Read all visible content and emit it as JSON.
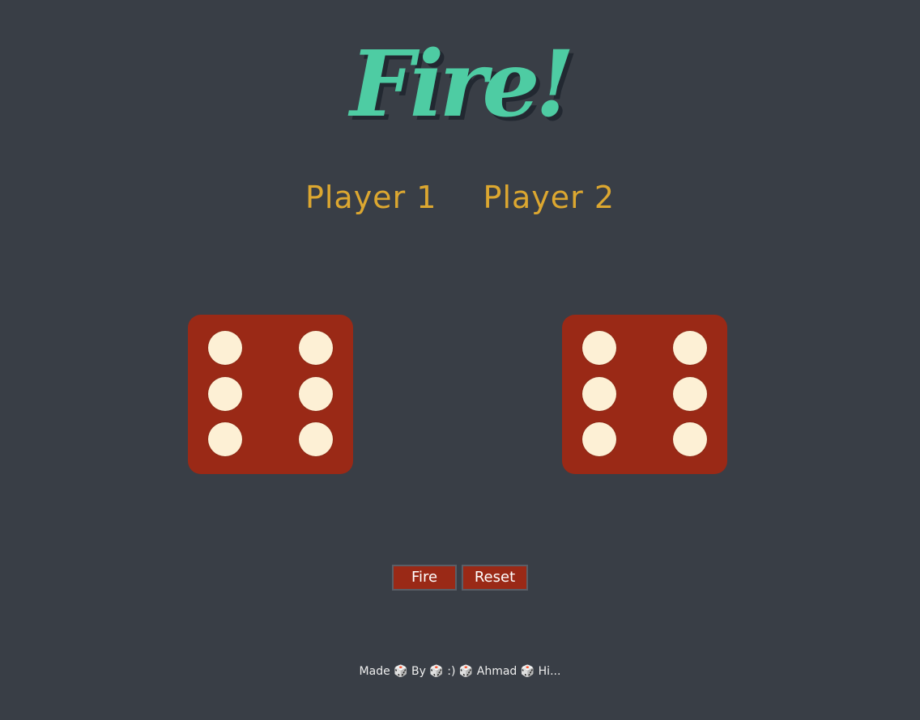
{
  "header": {
    "title": "Fire!"
  },
  "players": {
    "player1": "Player 1",
    "player2": "Player 2"
  },
  "dice": [
    {
      "player": "Player 1",
      "value": 6
    },
    {
      "player": "Player 2",
      "value": 6
    }
  ],
  "controls": {
    "fire_label": "Fire",
    "reset_label": "Reset"
  },
  "footer": {
    "text": "Made 🎲 By 🎲 :) 🎲 Ahmad 🎲 Hi..."
  },
  "colors": {
    "background": "#393e46",
    "title": "#4ecca3",
    "player_names": "#dca730",
    "die_face": "#9a2916",
    "pip": "#fdf0d5",
    "button": "#9a2916"
  }
}
